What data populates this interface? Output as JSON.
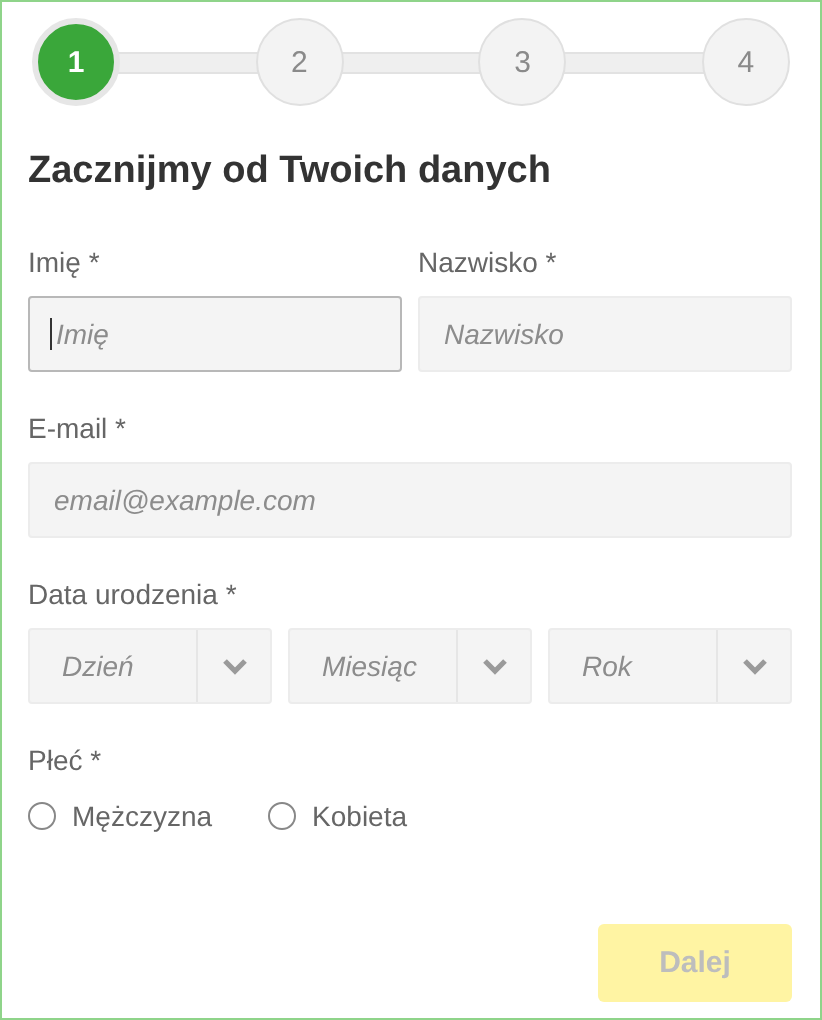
{
  "steps": [
    {
      "label": "1",
      "selected": true
    },
    {
      "label": "2",
      "selected": false
    },
    {
      "label": "3",
      "selected": false
    },
    {
      "label": "4",
      "selected": false
    }
  ],
  "heading": "Zacznijmy od Twoich danych",
  "name_fields": [
    {
      "label": "Imię *",
      "placeholder": "Imię",
      "focused": true
    },
    {
      "label": "Nazwisko *",
      "placeholder": "Nazwisko",
      "focused": false
    }
  ],
  "email": {
    "label": "E-mail *",
    "placeholder": "email@example.com",
    "focused": false
  },
  "birth_date": {
    "label": "Data urodzenia *",
    "selects": [
      {
        "placeholder": "Dzień"
      },
      {
        "placeholder": "Miesiąc"
      },
      {
        "placeholder": "Rok"
      }
    ]
  },
  "gender": {
    "label": "Płeć *",
    "options": [
      {
        "label": "Mężczyzna",
        "selected": false
      },
      {
        "label": "Kobieta",
        "selected": false
      }
    ]
  },
  "next_button": {
    "label": "Dalej",
    "disabled": true
  }
}
